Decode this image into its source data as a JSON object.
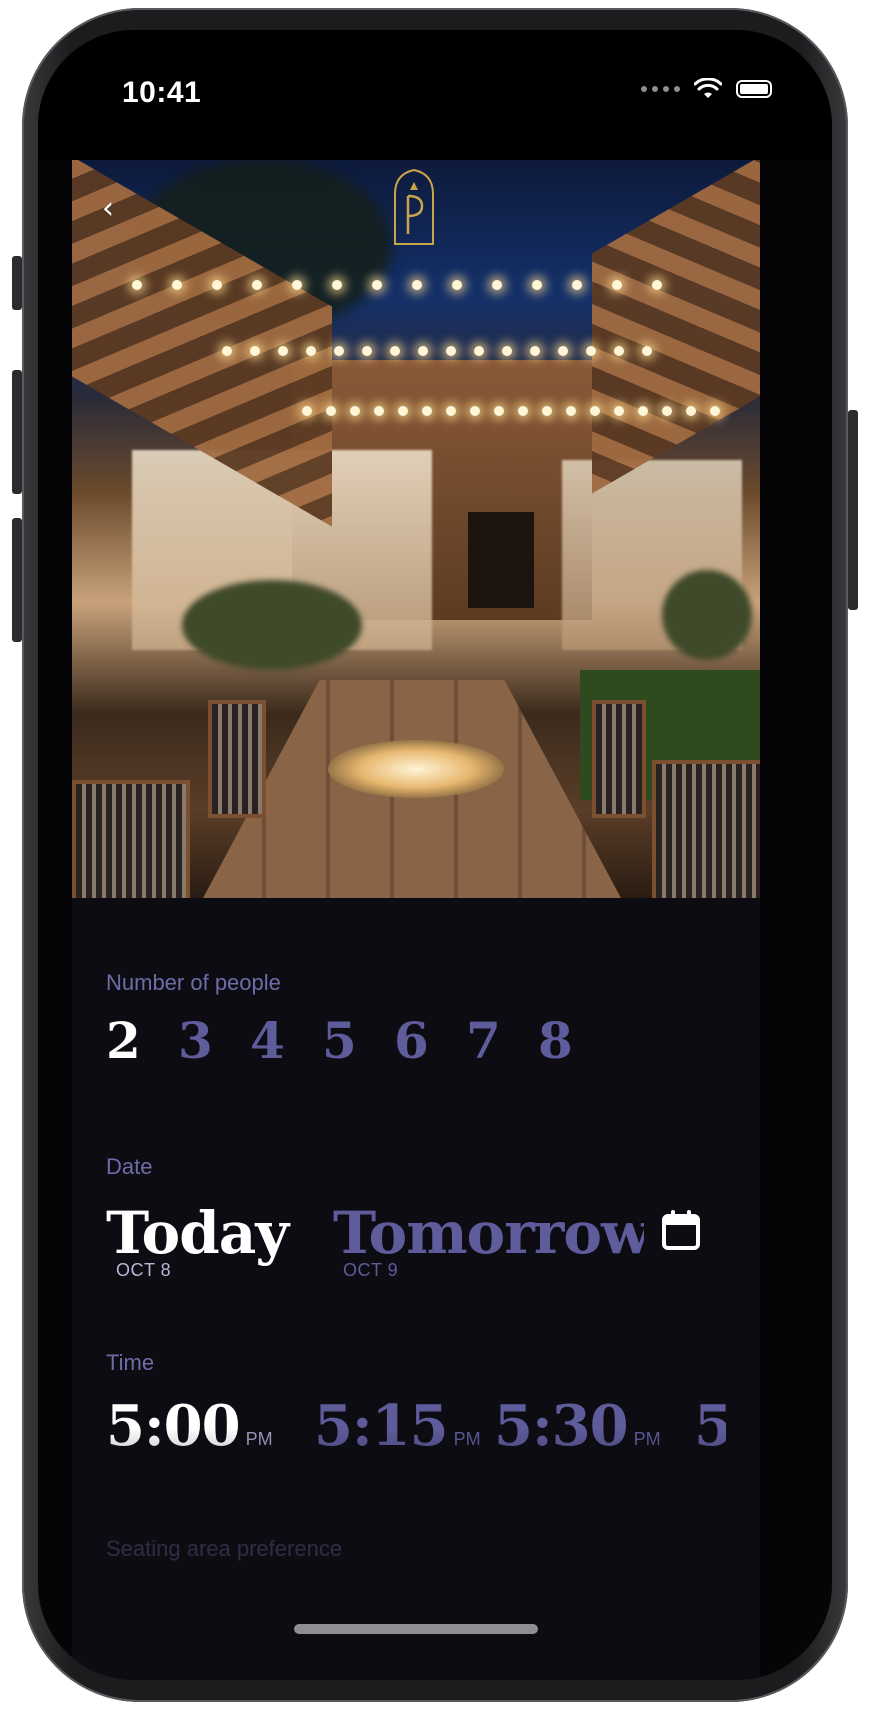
{
  "status_bar": {
    "time": "10:41",
    "icons": [
      "cellular-dots-icon",
      "wifi-icon",
      "battery-icon"
    ]
  },
  "header": {
    "back_icon": "chevron-left-icon",
    "logo": "restaurant-logo"
  },
  "party_size": {
    "label": "Number of people",
    "options": [
      "2",
      "3",
      "4",
      "5",
      "6",
      "7",
      "8"
    ],
    "selected": "2"
  },
  "date": {
    "label": "Date",
    "options": [
      {
        "label": "Today",
        "sub": "OCT 8",
        "selected": true
      },
      {
        "label": "Tomorrow",
        "sub": "OCT 9",
        "selected": false
      }
    ],
    "calendar_icon": "calendar-icon"
  },
  "time": {
    "label": "Time",
    "options": [
      {
        "value": "5:00",
        "ampm": "PM",
        "selected": true
      },
      {
        "value": "5:15",
        "ampm": "PM",
        "selected": false
      },
      {
        "value": "5:30",
        "ampm": "PM",
        "selected": false
      },
      {
        "value": "5",
        "ampm": "",
        "selected": false
      }
    ]
  },
  "seating": {
    "label": "Seating area preference"
  },
  "colors": {
    "accent": "#5e5c9a",
    "label": "#6e6ca8",
    "background": "#0d0c12",
    "selected": "#ffffff"
  }
}
